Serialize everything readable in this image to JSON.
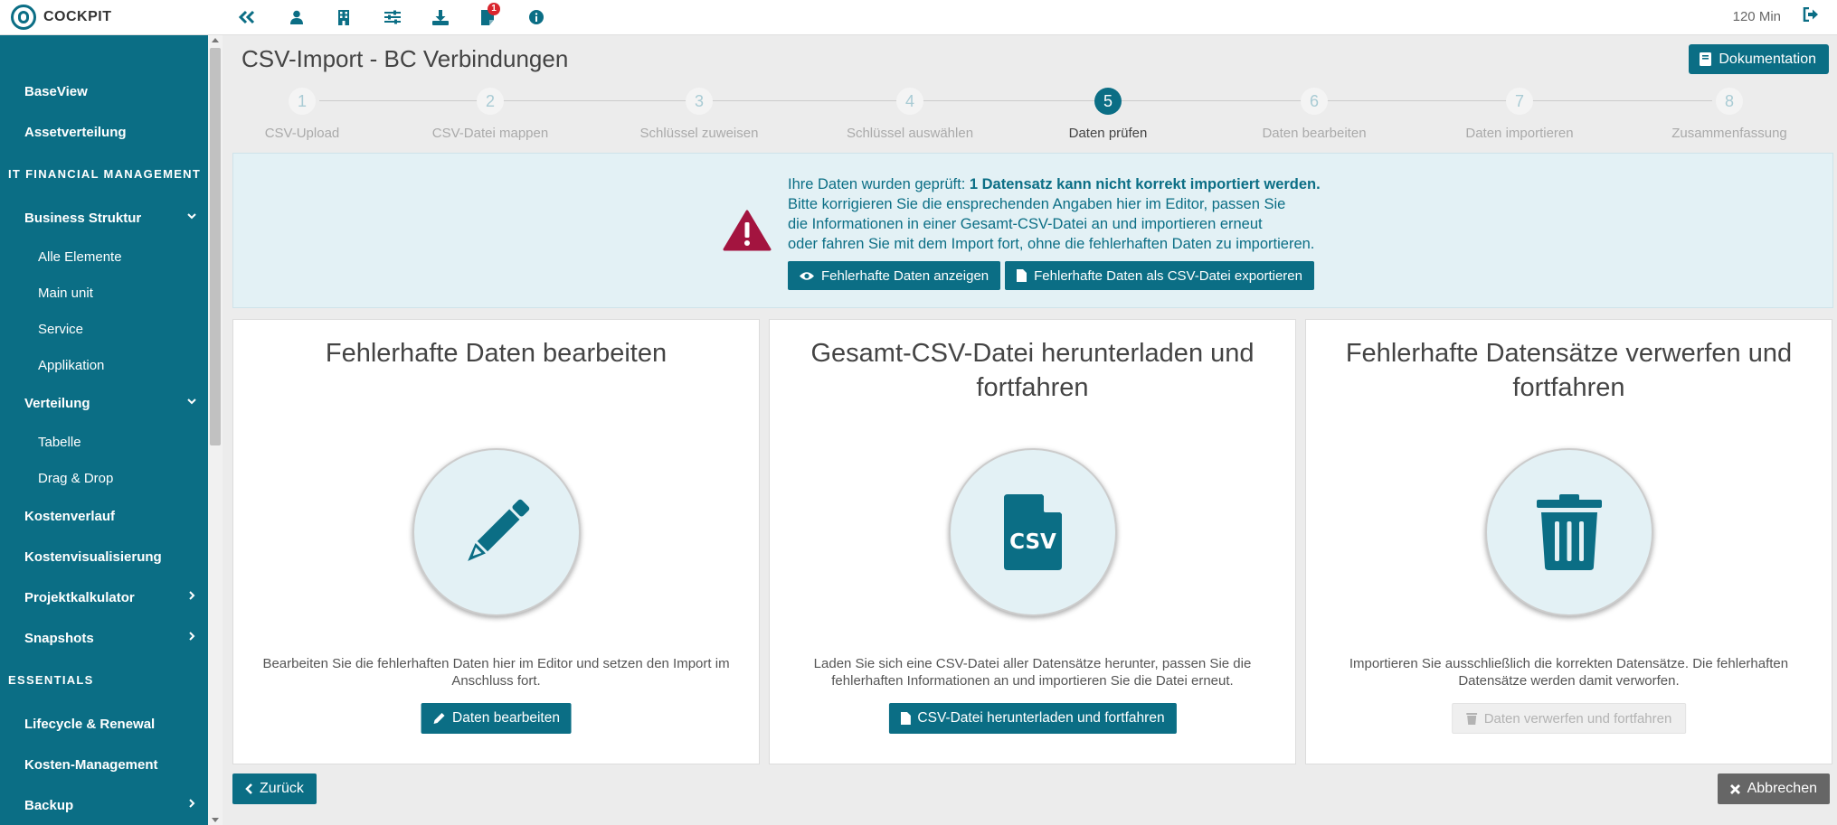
{
  "app": {
    "logo_text": "COCKPIT",
    "session_time": "120 Min",
    "notification_count": "1",
    "accent_color": "#0b6e85"
  },
  "toolbar": {
    "icons": [
      "double-chevron-left-icon",
      "user-icon",
      "building-icon",
      "sliders-icon",
      "download-icon",
      "notes-icon",
      "info-icon",
      "logout-icon"
    ]
  },
  "sidebar": {
    "items": [
      {
        "label": "BaseView"
      },
      {
        "label": "Assetverteilung"
      }
    ],
    "section1": "IT FINANCIAL MANAGEMENT",
    "business_struktur": {
      "label": "Business Struktur",
      "children": [
        "Alle Elemente",
        "Main unit",
        "Service",
        "Applikation"
      ]
    },
    "verteilung": {
      "label": "Verteilung",
      "children": [
        "Tabelle",
        "Drag & Drop"
      ]
    },
    "more_items": [
      "Kostenverlauf",
      "Kostenvisualisierung",
      "Projektkalkulator",
      "Snapshots"
    ],
    "section2": "ESSENTIALS",
    "essentials_items": [
      "Lifecycle & Renewal",
      "Kosten-Management",
      "Backup"
    ]
  },
  "page": {
    "title": "CSV-Import - BC Verbindungen",
    "doc_button": "Dokumentation"
  },
  "stepper": {
    "active_step": 5,
    "steps": [
      {
        "num": "1",
        "label": "CSV-Upload"
      },
      {
        "num": "2",
        "label": "CSV-Datei mappen"
      },
      {
        "num": "3",
        "label": "Schlüssel zuweisen"
      },
      {
        "num": "4",
        "label": "Schlüssel auswählen"
      },
      {
        "num": "5",
        "label": "Daten prüfen"
      },
      {
        "num": "6",
        "label": "Daten bearbeiten"
      },
      {
        "num": "7",
        "label": "Daten importieren"
      },
      {
        "num": "8",
        "label": "Zusammenfassung"
      }
    ]
  },
  "info": {
    "line1_prefix": "Ihre Daten wurden geprüft: ",
    "line1_bold": "1 Datensatz kann nicht korrekt importiert werden.",
    "line2": "Bitte korrigieren Sie die ensprechenden Angaben hier im Editor, passen Sie",
    "line3": "die Informationen in einer Gesamt-CSV-Datei an und importieren erneut",
    "line4": "oder fahren Sie mit dem Import fort, ohne die fehlerhaften Daten zu importieren.",
    "show_button": "Fehlerhafte Daten anzeigen",
    "export_button": "Fehlerhafte Daten als CSV-Datei exportieren"
  },
  "cards": [
    {
      "title": "Fehlerhafte Daten bearbeiten",
      "icon": "pencil-icon",
      "desc": "Bearbeiten Sie die fehlerhaften Daten hier im Editor und setzen den Import im Anschluss fort.",
      "button": "Daten bearbeiten"
    },
    {
      "title": "Gesamt-CSV-Datei herunterladen und fortfahren",
      "icon": "csv-file-icon",
      "icon_text": "CSV",
      "desc": "Laden Sie sich eine CSV-Datei aller Datensätze herunter, passen Sie die fehlerhaften Informationen an und importieren Sie die Datei erneut.",
      "button": "CSV-Datei herunterladen und fortfahren"
    },
    {
      "title": "Fehlerhafte Datensätze verwerfen und fortfahren",
      "icon": "trash-icon",
      "desc": "Importieren Sie ausschließlich die korrekten Datensätze. Die fehlerhaften Datensätze werden damit verworfen.",
      "button": "Daten verwerfen und fortfahren",
      "button_disabled": true
    }
  ],
  "footer": {
    "back_button": "Zurück",
    "cancel_button": "Abbrechen"
  }
}
